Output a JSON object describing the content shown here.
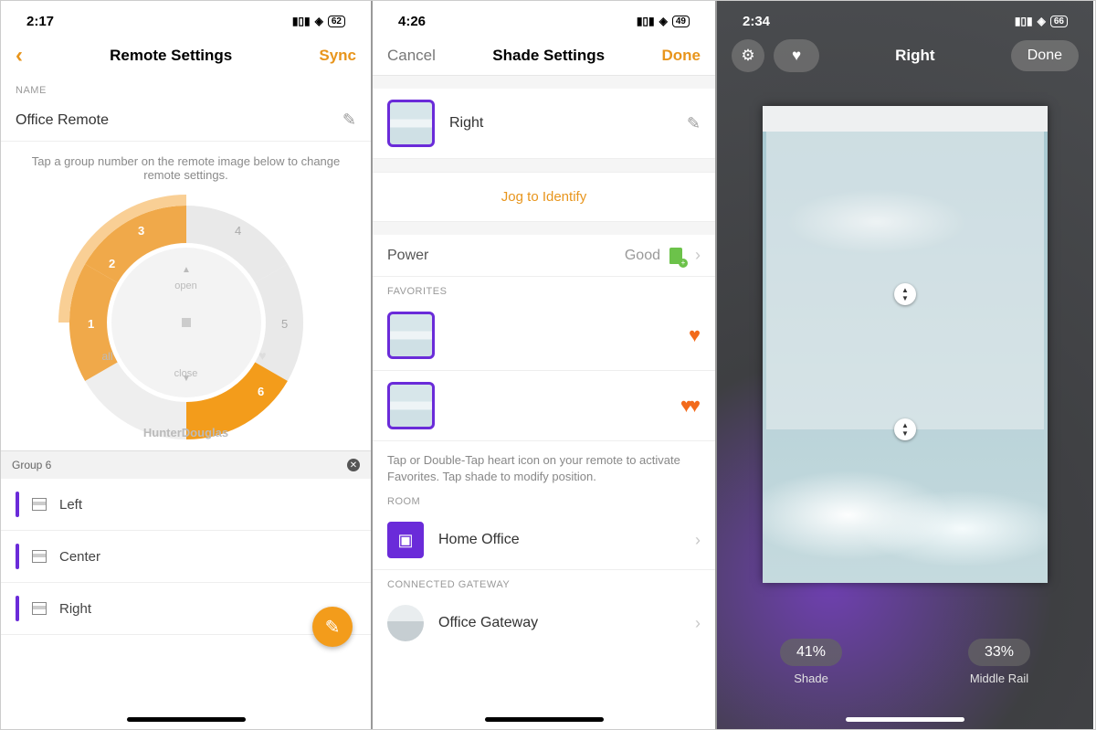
{
  "s1": {
    "time": "2:17",
    "batt": "62",
    "title": "Remote Settings",
    "sync": "Sync",
    "name_label": "NAME",
    "name_value": "Office Remote",
    "hint": "Tap a group number on the remote image below to change remote settings.",
    "open": "open",
    "close": "close",
    "all": "all",
    "brand": "HunterDouglas",
    "segments": [
      "1",
      "2",
      "3",
      "4",
      "5",
      "6"
    ],
    "group_header": "Group 6",
    "items": [
      {
        "label": "Left"
      },
      {
        "label": "Center"
      },
      {
        "label": "Right"
      }
    ]
  },
  "s2": {
    "time": "4:26",
    "batt": "49",
    "cancel": "Cancel",
    "title": "Shade Settings",
    "done": "Done",
    "shade_name": "Right",
    "jog": "Jog to Identify",
    "power_label": "Power",
    "power_value": "Good",
    "fav_label": "FAVORITES",
    "fav_hint": "Tap or Double-Tap heart icon on your remote to activate Favorites. Tap shade to modify position.",
    "room_label": "ROOM",
    "room_value": "Home Office",
    "gw_label": "CONNECTED GATEWAY",
    "gw_value": "Office Gateway"
  },
  "s3": {
    "time": "2:34",
    "batt": "66",
    "title": "Right",
    "done": "Done",
    "shade_pct": "41%",
    "shade_lab": "Shade",
    "mid_pct": "33%",
    "mid_lab": "Middle Rail"
  }
}
